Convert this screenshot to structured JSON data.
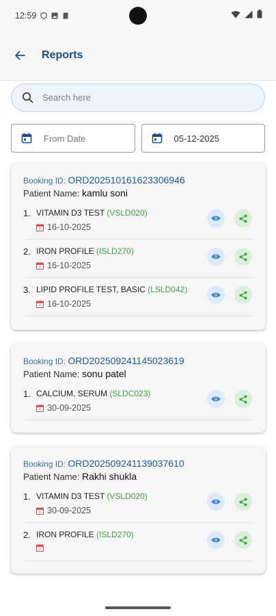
{
  "status_bar": {
    "time": "12:59"
  },
  "header": {
    "title": "Reports"
  },
  "search": {
    "placeholder": "Search here"
  },
  "filters": {
    "from_date_placeholder": "From Date",
    "to_date_value": "05-12-2025"
  },
  "labels": {
    "booking_id": "Booking ID:",
    "patient_name": "Patient Name:"
  },
  "bookings": [
    {
      "booking_id": "ORD202510161623306946",
      "patient_name": "kamlu soni",
      "tests": [
        {
          "number": "1.",
          "name": "VITAMIN D3 TEST",
          "code": "(VSLD020)",
          "date": "16-10-2025"
        },
        {
          "number": "2.",
          "name": "IRON PROFILE",
          "code": "(ISLD270)",
          "date": "16-10-2025"
        },
        {
          "number": "3.",
          "name": "LIPID PROFILE TEST, BASIC",
          "code": "(LSLD042)",
          "date": "16-10-2025"
        }
      ]
    },
    {
      "booking_id": "ORD202509241145023619",
      "patient_name": "sonu patel",
      "tests": [
        {
          "number": "1.",
          "name": "CALCIUM, SERUM",
          "code": "(SLDC023)",
          "date": "30-09-2025"
        }
      ]
    },
    {
      "booking_id": "ORD202509241139037610",
      "patient_name": "Rakhi shukla",
      "tests": [
        {
          "number": "1.",
          "name": "VITAMIN D3 TEST",
          "code": "(VSLD020)",
          "date": "30-09-2025"
        },
        {
          "number": "2.",
          "name": "IRON PROFILE",
          "code": "(ISLD270)",
          "date": ""
        }
      ]
    }
  ],
  "colors": {
    "accent": "#1e4c86",
    "code_green": "#43a047",
    "view_bg": "#dbe9f8",
    "share_bg": "#d9efda"
  }
}
